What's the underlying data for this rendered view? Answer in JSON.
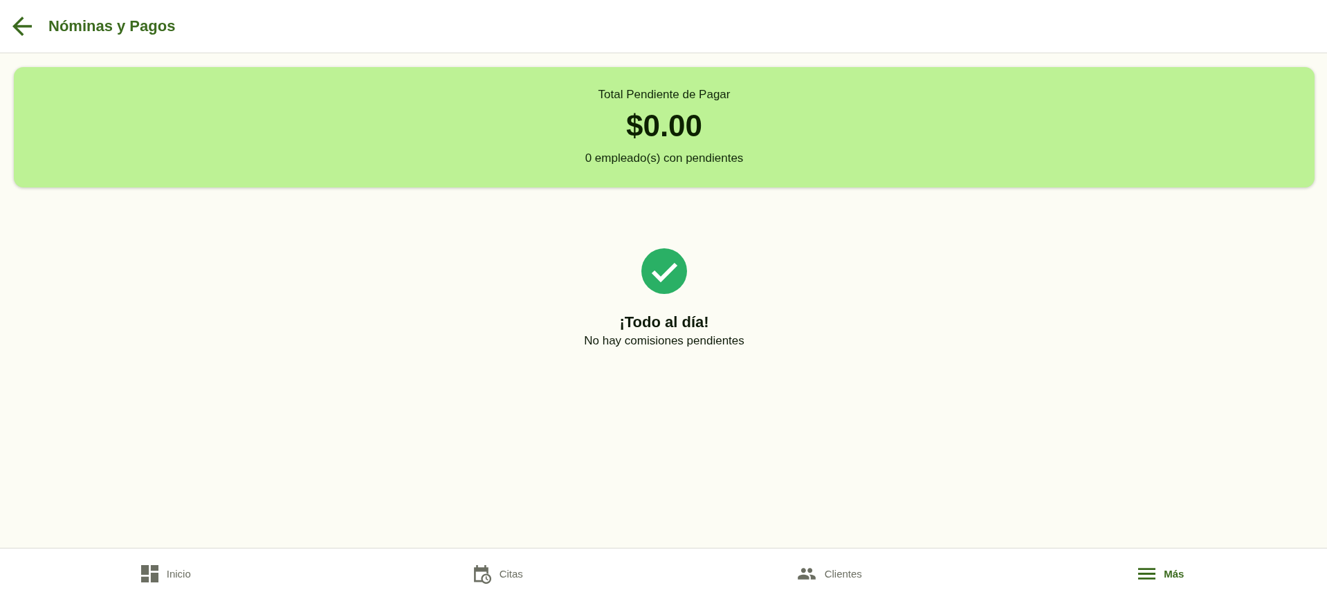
{
  "header": {
    "title": "Nóminas y Pagos"
  },
  "summary": {
    "label": "Total Pendiente de Pagar",
    "amount": "$0.00",
    "note": "0 empleado(s) con pendientes"
  },
  "empty_state": {
    "title": "¡Todo al día!",
    "message": "No hay comisiones pendientes"
  },
  "bottom_nav": [
    {
      "kind": "dashboard",
      "label": "Inicio",
      "selected": false
    },
    {
      "kind": "calendar",
      "label": "Citas",
      "selected": false
    },
    {
      "kind": "people",
      "label": "Clientes",
      "selected": false
    },
    {
      "kind": "menu",
      "label": "Más",
      "selected": true
    }
  ]
}
